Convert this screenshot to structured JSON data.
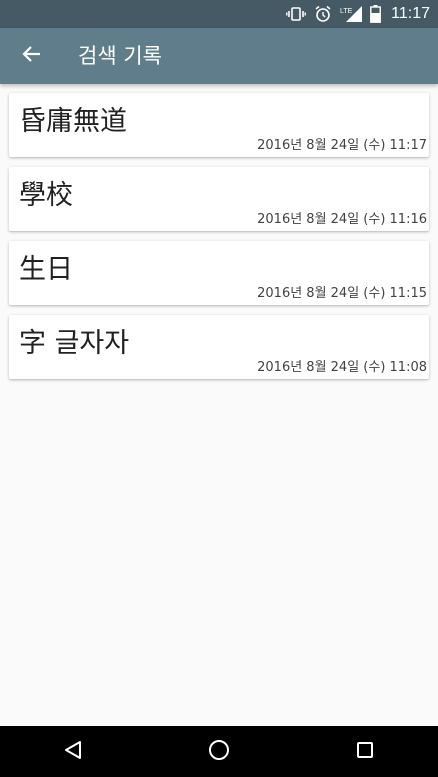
{
  "status_bar": {
    "time": "11:17",
    "icons": [
      "vibrate-icon",
      "alarm-icon",
      "lte-signal-icon",
      "battery-icon"
    ],
    "network_label": "LTE"
  },
  "app_bar": {
    "title": "검색 기록",
    "back_icon": "arrow-back-icon"
  },
  "history": [
    {
      "word": "昏庸無道",
      "date": "2016년 8월 24일 (수) 11:17"
    },
    {
      "word": "學校",
      "date": "2016년 8월 24일 (수) 11:16"
    },
    {
      "word": "生日",
      "date": "2016년 8월 24일 (수) 11:15"
    },
    {
      "word": "字 글자자",
      "date": "2016년 8월 24일 (수) 11:08"
    }
  ],
  "nav_bar": {
    "back_icon": "nav-back-icon",
    "home_icon": "nav-home-icon",
    "recents_icon": "nav-recents-icon"
  },
  "colors": {
    "status_bar": "#455a64",
    "app_bar": "#607d8b",
    "background": "#fafafa",
    "card": "#ffffff",
    "nav_bar": "#000000"
  }
}
